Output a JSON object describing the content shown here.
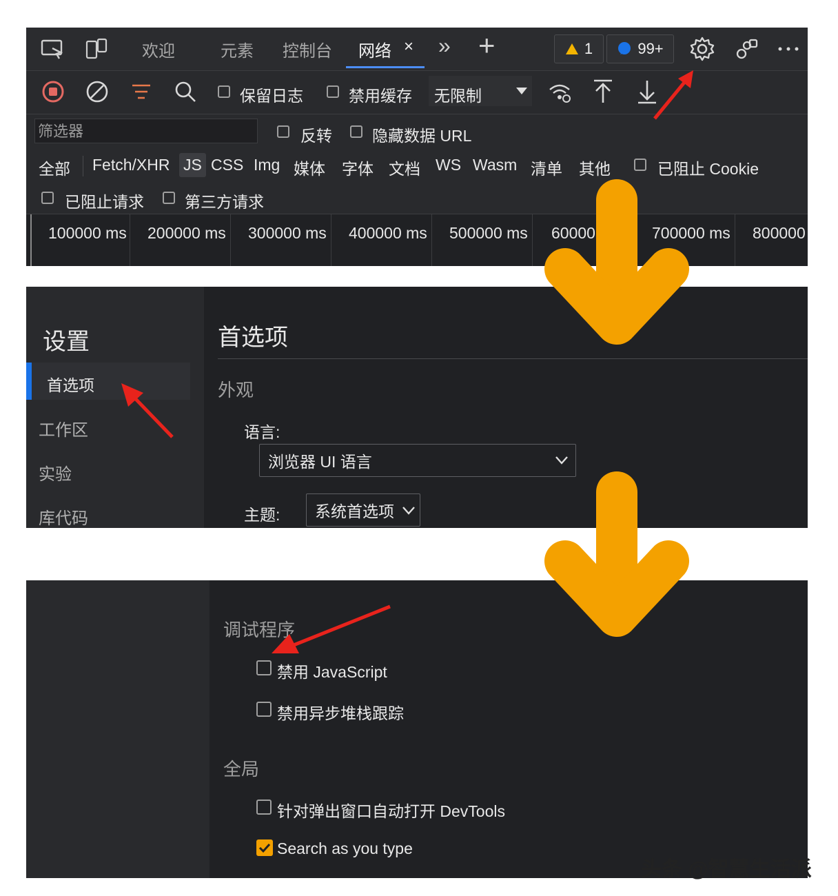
{
  "colors": {
    "accent": "#4c8df6",
    "orange_arrow": "#f4a100",
    "red_arrow": "#e8231c",
    "checkbox_checked": "#f4a100"
  },
  "panel1": {
    "tabs": [
      "欢迎",
      "元素",
      "控制台",
      "网络"
    ],
    "active_tab": "网络",
    "tab_close": "×",
    "more_tabs": "»",
    "add_tab": "+",
    "warning_count": "1",
    "message_count": "99+",
    "toolbar": {
      "preserve_log": "保留日志",
      "disable_cache": "禁用缓存",
      "throttle": "无限制"
    },
    "filter": {
      "placeholder": "筛选器",
      "invert": "反转",
      "hide_data_url": "隐藏数据 URL"
    },
    "types": [
      "全部",
      "Fetch/XHR",
      "JS",
      "CSS",
      "Img",
      "媒体",
      "字体",
      "文档",
      "WS",
      "Wasm",
      "清单",
      "其他"
    ],
    "blocked_cookies": "已阻止 Cookie",
    "blocked_requests": "已阻止请求",
    "third_party": "第三方请求",
    "timeline_ticks": [
      "100000 ms",
      "200000 ms",
      "300000 ms",
      "400000 ms",
      "500000 ms",
      "60000",
      "700000 ms",
      "800000"
    ]
  },
  "panel2": {
    "settings_title": "设置",
    "nav": [
      "首选项",
      "工作区",
      "实验",
      "库代码"
    ],
    "page_title": "首选项",
    "section": "外观",
    "language_label": "语言:",
    "language_value": "浏览器 UI 语言",
    "theme_label": "主题:",
    "theme_value": "系统首选项"
  },
  "panel3": {
    "section_debugger": "调试程序",
    "disable_js": "禁用 JavaScript",
    "disable_async": "禁用异步堆栈跟踪",
    "section_global": "全局",
    "auto_open_devtools": "针对弹出窗口自动打开 DevTools",
    "search_as_you_type": "Search as you type",
    "search_as_you_type_checked": true
  },
  "watermark": "头条 @智慧生活派"
}
